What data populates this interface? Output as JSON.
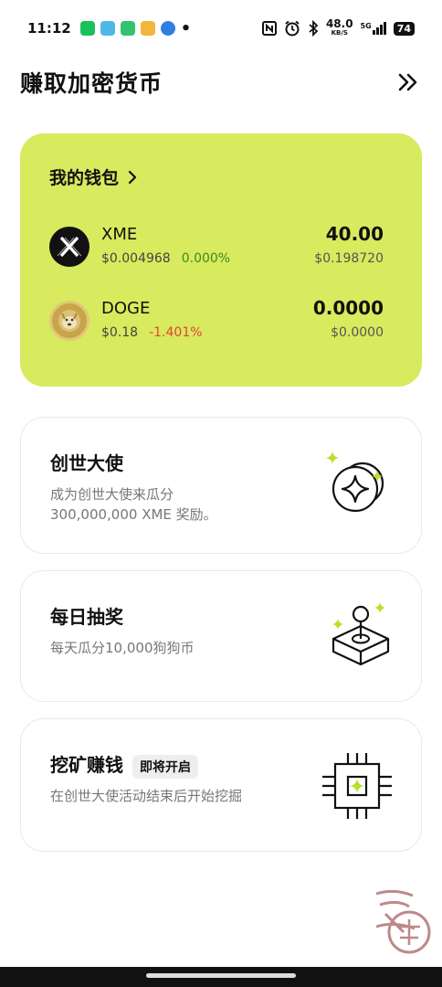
{
  "status_bar": {
    "time": "11:12",
    "net_speed_value": "48.0",
    "net_speed_unit": "KB/S",
    "signal": "5G",
    "battery": "74"
  },
  "header": {
    "title": "赚取加密货币"
  },
  "wallet": {
    "title": "我的钱包",
    "coins": [
      {
        "name": "XME",
        "price": "$0.004968",
        "change": "0.000%",
        "amount": "40.00",
        "value": "$0.198720",
        "icon": "xme-logo"
      },
      {
        "name": "DOGE",
        "price": "$0.18",
        "change": "-1.401%",
        "amount": "0.0000",
        "value": "$0.0000",
        "icon": "doge-logo"
      }
    ]
  },
  "features": [
    {
      "title": "创世大使",
      "desc_line1": "成为创世大使来瓜分",
      "desc_line2": "300,000,000 XME 奖励。",
      "icon": "coins-sparkle-icon"
    },
    {
      "title": "每日抽奖",
      "desc_line1": "每天瓜分10,000狗狗币",
      "icon": "joystick-icon"
    },
    {
      "title": "挖矿赚钱",
      "badge": "即将开启",
      "desc_line1": "在创世大使活动结束后开始挖掘",
      "icon": "chip-icon"
    }
  ],
  "colors": {
    "accent": "#d8ea5e",
    "positive": "#3c8a1c",
    "negative": "#e0443c"
  }
}
